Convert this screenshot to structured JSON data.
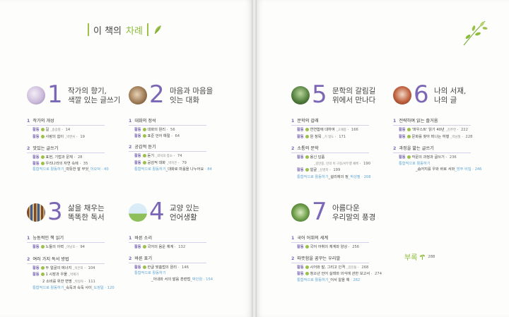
{
  "toc": {
    "title_a": "이 책의",
    "title_b": "차례"
  },
  "chapters": [
    {
      "num": "1",
      "title1": "작가의 향기,",
      "title2": "색깔 있는 글쓰기",
      "sections": [
        {
          "n": "1",
          "title": "작가의 개성",
          "items": [
            {
              "label": "활동",
              "text": "길",
              "author": "_송승철",
              "page": "14"
            },
            {
              "label": "활동",
              "text": "사랑의 힘이",
              "author": "_박완서",
              "page": "19"
            }
          ]
        },
        {
          "n": "2",
          "title": "맛있는 글쓰기",
          "items": [
            {
              "label": "활동",
              "text": "표현, 기법과 문체",
              "author": "",
              "page": "28"
            },
            {
              "label": "활동",
              "text": "우리나라의 자연 속에",
              "author": "",
              "page": "35"
            }
          ]
        }
      ],
      "integ": {
        "label": "통합적으로 활동하기",
        "text": "_따뜻한 말 무엇",
        "author": "_이오덕",
        "page": "40"
      }
    },
    {
      "num": "2",
      "title1": "마음과 마음을",
      "title2": "잇는 대화",
      "sections": [
        {
          "n": "1",
          "title": "대화의 정석",
          "items": [
            {
              "label": "활동",
              "text": "대화의 원리",
              "author": "",
              "page": "56"
            },
            {
              "label": "활동",
              "text": "표준 언어 예절",
              "author": "",
              "page": "64"
            }
          ]
        },
        {
          "n": "2",
          "title": "공감적 듣기",
          "items": [
            {
              "label": "활동",
              "text": "듣기",
              "author": "_외덕의 창소",
              "page": "74"
            },
            {
              "label": "활동",
              "text": "공감적 대화",
              "author": "_박지은",
              "page": "79"
            }
          ]
        }
      ],
      "integ": {
        "label": "통합적으로 활동하기",
        "text": "_대화로 마음을 나누어요",
        "author": "",
        "page": "84"
      }
    },
    {
      "num": "3",
      "title1": "삶을 채우는",
      "title2": "똑똑한 독서",
      "sections": [
        {
          "n": "1",
          "title": "능동적인 책 읽기",
          "items": [
            {
              "label": "활동",
              "text": "노들의 이력",
              "author": "_이남호",
              "page": "94"
            }
          ]
        },
        {
          "n": "2",
          "title": "여러 가지 독서 방법",
          "items": [
            {
              "label": "활동",
              "text": "두 얼굴의 에너지",
              "author": "_이은희",
              "page": "104"
            },
            {
              "label": "활동",
              "text": "1 시장과 우물",
              "author": "_박제가",
              "page": ""
            },
            {
              "label": "",
              "text": "2 소비를 위한 변명",
              "author": "_박정자",
              "page": "111"
            }
          ]
        }
      ],
      "integ": {
        "label": "통합적으로 활동하기",
        "text": "_숙독과 숙독 사이",
        "author": "_도정일",
        "page": "120"
      }
    },
    {
      "num": "4",
      "title1": "교양 있는",
      "title2": "언어생활",
      "sections": [
        {
          "n": "1",
          "title": "바른 소리",
          "items": [
            {
              "label": "활동",
              "text": "국어의 음운 체계",
              "author": "",
              "page": "132"
            }
          ]
        },
        {
          "n": "2",
          "title": "바른 표기",
          "items": [
            {
              "label": "활동",
              "text": "한글 맞춤법의 원리",
              "author": "",
              "page": "146"
            }
          ]
        }
      ],
      "integ": {
        "label": "통합적으로 활동하기",
        "text": "_아내와 서의 발음 훈련법",
        "author": "_박인원",
        "page": "154"
      }
    },
    {
      "num": "5",
      "title1": "문학의 갈림길",
      "title2": "위에서 만나다",
      "sections": [
        {
          "n": "1",
          "title": "문학의 갈래",
          "items": [
            {
              "label": "활동",
              "text": "연연합에 대하여",
              "author": "_고재종",
              "page": "166"
            },
            {
              "label": "활동",
              "text": "원 청목",
              "author": "_기 형도",
              "page": "171"
            }
          ]
        },
        {
          "n": "2",
          "title": "소통의 문학",
          "items": [
            {
              "label": "활동",
              "text": "용신 답품",
              "author": "",
              "page": ""
            },
            {
              "label": "",
              "text": "_김만중, 민의 이 구옹/서두행 채록",
              "author": "",
              "page": "190"
            },
            {
              "label": "활동",
              "text": "얼굴",
              "author": "_신영목",
              "page": "199"
            }
          ]
        }
      ],
      "integ": {
        "label": "통합적으로 활동하기",
        "text": "_설리에의 정",
        "author": "_박성필",
        "page": "208"
      }
    },
    {
      "num": "6",
      "title1": "나의 서재,",
      "title2": "나의 글",
      "sections": [
        {
          "n": "1",
          "title": "전략하며 읽는 즐거움",
          "items": [
            {
              "label": "활동",
              "text": "'파우스트' 읽기 40년",
              "author": "_김주연",
              "page": "222"
            },
            {
              "label": "활동",
              "text": "문화를 찾아 떠나는 여행",
              "author": "_박남철",
              "page": "228"
            }
          ]
        },
        {
          "n": "2",
          "title": "과정을 밟는 글쓰기",
          "items": [
            {
              "label": "활동",
              "text": "작문의 과정과 글쓰기",
              "author": "",
              "page": "236"
            }
          ]
        }
      ],
      "integ": {
        "label": "통합적으로 활동하기",
        "text": "_숨어지를 우와 바로 서와",
        "author": "_방주 비집",
        "page": "246"
      }
    },
    {
      "num": "7",
      "title1": "아름다운",
      "title2": "우리말의 풍경",
      "sections": [
        {
          "n": "1",
          "title": "국어 어휘의 세계",
          "items": [
            {
              "label": "활동",
              "text": "국어 어휘의 체계와 양상",
              "author": "",
              "page": "256"
            }
          ]
        },
        {
          "n": "2",
          "title": "따뜻함을 꿈꾸는 우리말",
          "items": [
            {
              "label": "활동",
              "text": "시어와 말, 그리고 인격",
              "author": "_김진돌",
              "page": "268"
            },
            {
              "label": "활동",
              "text": "청소년 언어 실태와 의식에 관한 보고서",
              "author": "",
              "page": "274"
            }
          ]
        }
      ],
      "integ": {
        "label": "통합적으로 활동하기",
        "text": "_어서 알을 해",
        "author": "",
        "page": "282"
      }
    }
  ],
  "appendix": {
    "label": "부록",
    "page": "288"
  },
  "colors": {
    "accent_purple": "#7b67b5",
    "accent_green": "#9cc04a",
    "link_blue": "#5fa6d6"
  }
}
